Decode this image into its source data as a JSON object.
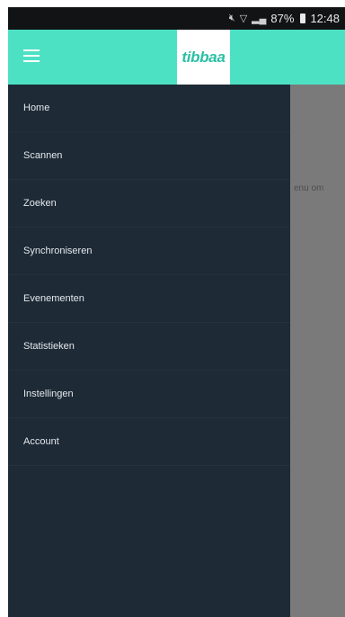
{
  "status_bar": {
    "icons_text": "❙❙✕ ▽ ▎",
    "battery": "87%",
    "time": "12:48"
  },
  "app_bar": {
    "logo": "tibbaa",
    "background": "#4de1c4"
  },
  "background_content": {
    "fragment": "enu om"
  },
  "drawer": {
    "background": "#1e2a36",
    "items": [
      {
        "label": "Home"
      },
      {
        "label": "Scannen"
      },
      {
        "label": "Zoeken"
      },
      {
        "label": "Synchroniseren"
      },
      {
        "label": "Evenementen"
      },
      {
        "label": "Statistieken"
      },
      {
        "label": "Instellingen"
      },
      {
        "label": "Account"
      }
    ]
  }
}
